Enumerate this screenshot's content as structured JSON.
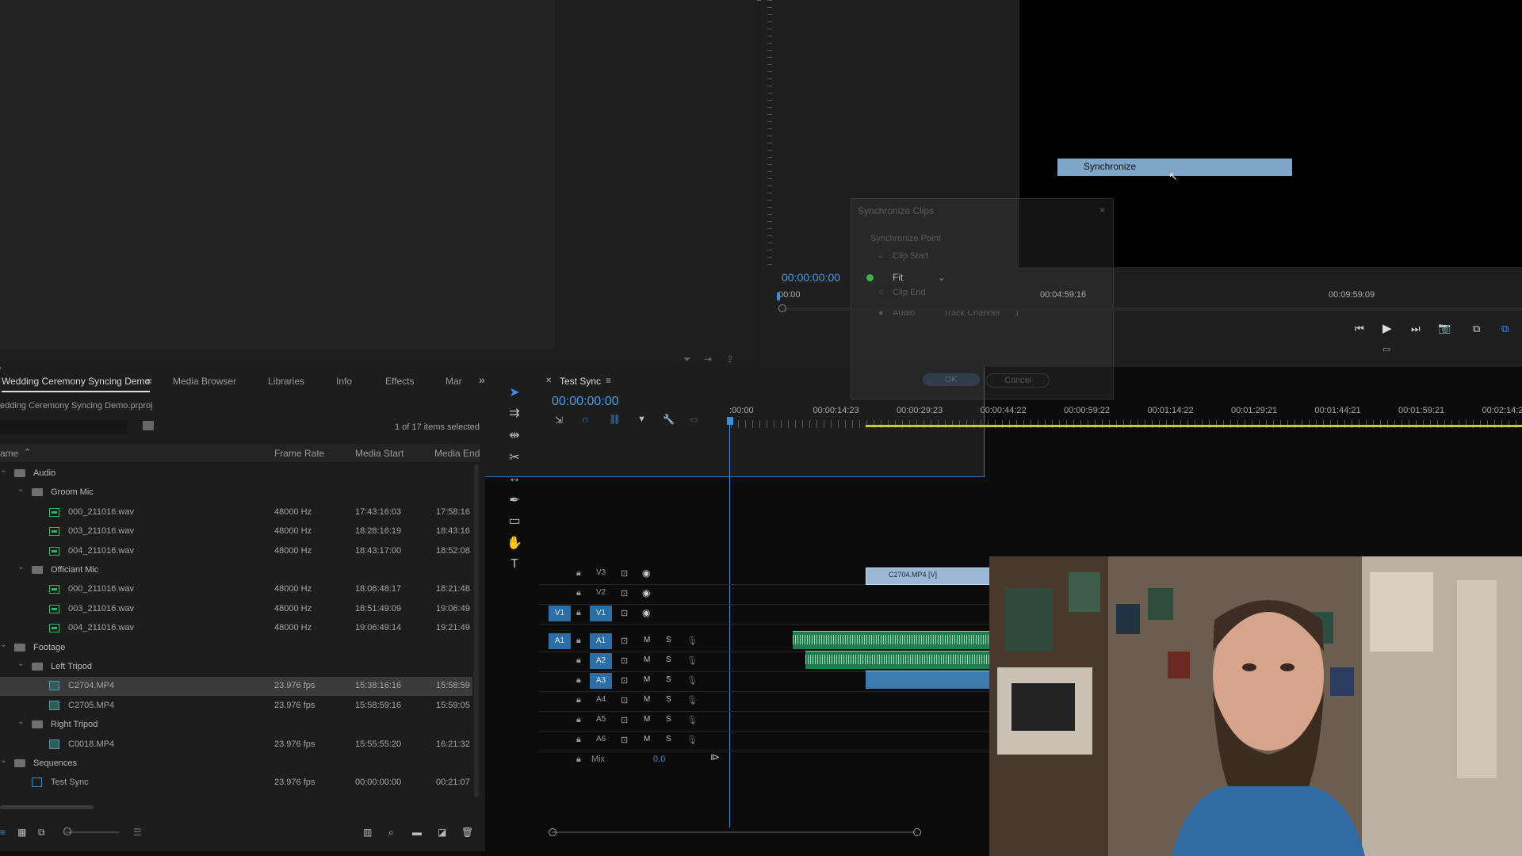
{
  "program": {
    "timecode": "00:00:00:00",
    "ruler_ticks": [
      "00:00",
      "00:04:59:16",
      "00:09:59:09"
    ],
    "fit_label": "Fit"
  },
  "dialog": {
    "title": "Synchronize Clips",
    "section": "Synchronize Point",
    "option_clip_start": "Clip Start",
    "option_clip_end": "Clip End",
    "option_audio": "Audio",
    "track_channel_label": "Track Channel",
    "track_channel_value": "1",
    "ok": "OK",
    "cancel": "Cancel"
  },
  "context_menu": {
    "item": "Synchronize"
  },
  "project": {
    "tabs": [
      "Wedding Ceremony Syncing Demo",
      "Media Browser",
      "Libraries",
      "Info",
      "Effects",
      "Mar"
    ],
    "path": "edding Ceremony Syncing Demo.prproj",
    "selection_status": "1 of 17 items selected",
    "columns": {
      "name": "ame",
      "frame_rate": "Frame Rate",
      "media_start": "Media Start",
      "media_end": "Media End"
    },
    "rows": [
      {
        "name": "Audio",
        "level": 0,
        "kind": "folder",
        "rate": "",
        "start": "",
        "end": ""
      },
      {
        "name": "Groom Mic",
        "level": 1,
        "kind": "folder",
        "rate": "",
        "start": "",
        "end": ""
      },
      {
        "name": "000_211016.wav",
        "level": 2,
        "kind": "audio",
        "rate": "48000 Hz",
        "start": "17:43:16:03",
        "end": "17:58:16"
      },
      {
        "name": "003_211016.wav",
        "level": 2,
        "kind": "audio",
        "rate": "48000 Hz",
        "start": "18:28:16:19",
        "end": "18:43:16"
      },
      {
        "name": "004_211016.wav",
        "level": 2,
        "kind": "audio",
        "rate": "48000 Hz",
        "start": "18:43:17:00",
        "end": "18:52:08"
      },
      {
        "name": "Officiant Mic",
        "level": 1,
        "kind": "folder",
        "rate": "",
        "start": "",
        "end": ""
      },
      {
        "name": "000_211016.wav",
        "level": 2,
        "kind": "audio",
        "rate": "48000 Hz",
        "start": "18:06:48:17",
        "end": "18:21:48"
      },
      {
        "name": "003_211016.wav",
        "level": 2,
        "kind": "audio",
        "rate": "48000 Hz",
        "start": "18:51:49:09",
        "end": "19:06:49"
      },
      {
        "name": "004_211016.wav",
        "level": 2,
        "kind": "audio",
        "rate": "48000 Hz",
        "start": "19:06:49:14",
        "end": "19:21:49"
      },
      {
        "name": "Footage",
        "level": 0,
        "kind": "folder",
        "rate": "",
        "start": "",
        "end": ""
      },
      {
        "name": "Left Tripod",
        "level": 1,
        "kind": "folder",
        "rate": "",
        "start": "",
        "end": ""
      },
      {
        "name": "C2704.MP4",
        "level": 2,
        "kind": "video",
        "rate": "23.976 fps",
        "start": "15:38:16:16",
        "end": "15:58:59",
        "selected": true
      },
      {
        "name": "C2705.MP4",
        "level": 2,
        "kind": "video",
        "rate": "23.976 fps",
        "start": "15:58:59:16",
        "end": "15:59:05"
      },
      {
        "name": "Right Tripod",
        "level": 1,
        "kind": "folder",
        "rate": "",
        "start": "",
        "end": ""
      },
      {
        "name": "C0018.MP4",
        "level": 2,
        "kind": "video",
        "rate": "23.976 fps",
        "start": "15:55:55:20",
        "end": "16:21:32"
      },
      {
        "name": "Sequences",
        "level": 0,
        "kind": "folder",
        "rate": "",
        "start": "",
        "end": ""
      },
      {
        "name": "Test Sync",
        "level": 1,
        "kind": "sequence",
        "rate": "23.976 fps",
        "start": "00:00:00:00",
        "end": "00:21:07"
      }
    ]
  },
  "timeline": {
    "tab": "Test Sync",
    "timecode": "00:00:00:00",
    "ticks": [
      ":00:00",
      "00:00:14:23",
      "00:00:29:23",
      "00:00:44:22",
      "00:00:59:22",
      "00:01:14:22",
      "00:01:29:21",
      "00:01:44:21",
      "00:01:59:21",
      "00:02:14:20"
    ],
    "video_tracks": [
      "V3",
      "V2",
      "V1"
    ],
    "audio_tracks": [
      "A1",
      "A2",
      "A3",
      "A4",
      "A5",
      "A6"
    ],
    "source_v": "V1",
    "source_a": "A1",
    "mute": "M",
    "solo": "S",
    "mix_label": "Mix",
    "mix_value": "0.0",
    "clip_v3": "C2704.MP4 [V]"
  },
  "colors": {
    "accent": "#2c6ea6",
    "timecode_blue": "#4a9be6",
    "audio_clip": "#1f7d4f",
    "video_clip": "#9bb7d6"
  }
}
